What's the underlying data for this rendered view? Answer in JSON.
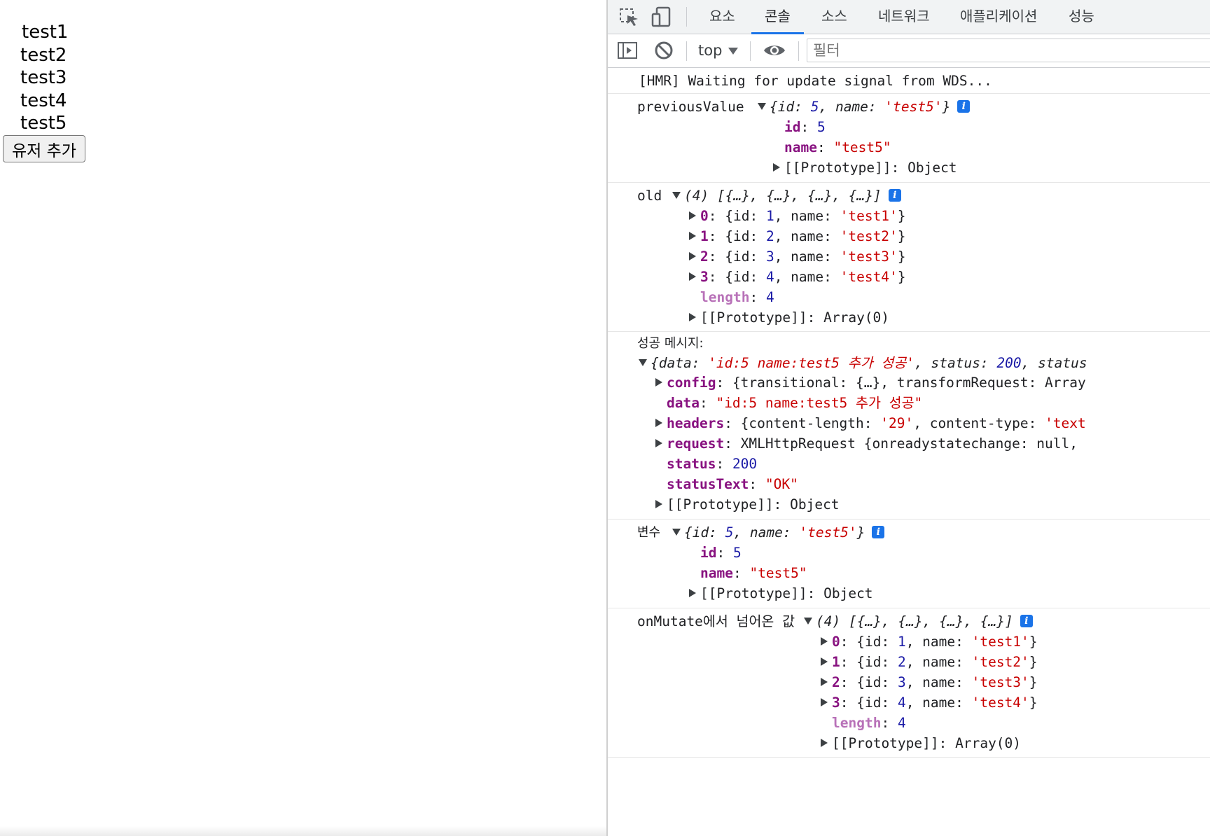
{
  "page": {
    "users": [
      "test1",
      "test2",
      "test3",
      "test4",
      "test5"
    ],
    "add_button": "유저 추가"
  },
  "devtools": {
    "tabs": [
      "요소",
      "콘솔",
      "소스",
      "네트워크",
      "애플리케이션",
      "성능"
    ],
    "active_tab": "콘솔",
    "context": "top",
    "filter_placeholder": "필터",
    "icons": [
      "inspect-element-icon",
      "device-toolbar-icon",
      "sidebar-toggle-icon",
      "clear-console-icon",
      "live-expression-eye-icon"
    ],
    "accent_color": "#1a73e8"
  },
  "console": {
    "hmr": "[HMR] Waiting for update signal from WDS...",
    "previousValue": {
      "label": "previousValue",
      "preview": "{id: 5, name: 'test5'}",
      "id": "5",
      "name": "\"test5\"",
      "proto": "Object"
    },
    "old": {
      "label": "old",
      "preview": "(4) [{…}, {…}, {…}, {…}]",
      "items": [
        {
          "index": "0",
          "id": "1",
          "name": "'test1'"
        },
        {
          "index": "1",
          "id": "2",
          "name": "'test2'"
        },
        {
          "index": "2",
          "id": "3",
          "name": "'test3'"
        },
        {
          "index": "3",
          "id": "4",
          "name": "'test4'"
        }
      ],
      "length": "4",
      "proto": "Array(0)"
    },
    "success": {
      "label": "성공 메시지:",
      "preview_data": "'id:5 name:test5 추가 성공'",
      "preview_status": "200",
      "config": "{transitional: {…}, transformRequest: Array",
      "data": "\"id:5 name:test5 추가 성공\"",
      "headers_len": "'29'",
      "headers_type": "'text",
      "request": "XMLHttpRequest {onreadystatechange: null,",
      "status": "200",
      "statusText": "\"OK\"",
      "proto": "Object"
    },
    "variable": {
      "label": "변수",
      "preview": "{id: 5, name: 'test5'}",
      "id": "5",
      "name": "\"test5\"",
      "proto": "Object"
    },
    "onMutate": {
      "label": "onMutate에서 넘어온 값",
      "preview": "(4) [{…}, {…}, {…}, {…}]",
      "items": [
        {
          "index": "0",
          "id": "1",
          "name": "'test1'"
        },
        {
          "index": "1",
          "id": "2",
          "name": "'test2'"
        },
        {
          "index": "2",
          "id": "3",
          "name": "'test3'"
        },
        {
          "index": "3",
          "id": "4",
          "name": "'test4'"
        }
      ],
      "length": "4",
      "proto": "Array(0)"
    }
  }
}
